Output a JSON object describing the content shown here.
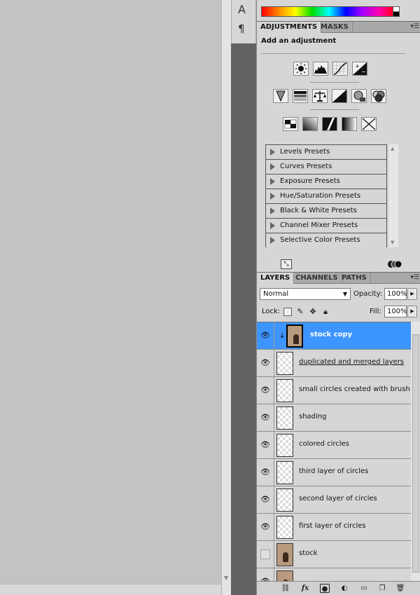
{
  "tools": {
    "type_tool": "A",
    "paragraph": "¶"
  },
  "adjustments": {
    "tabs": [
      "ADJUSTMENTS",
      "MASKS"
    ],
    "heading": "Add an adjustment",
    "row1": [
      "brightness-contrast-icon",
      "levels-icon",
      "curves-icon",
      "exposure-icon"
    ],
    "row2": [
      "vibrance-icon",
      "hue-saturation-icon",
      "color-balance-icon",
      "black-white-icon",
      "photo-filter-icon",
      "channel-mixer-icon"
    ],
    "row3": [
      "invert-icon",
      "posterize-icon",
      "threshold-icon",
      "gradient-map-icon",
      "selective-color-icon"
    ],
    "presets": [
      "Levels Presets",
      "Curves Presets",
      "Exposure Presets",
      "Hue/Saturation Presets",
      "Black & White Presets",
      "Channel Mixer Presets",
      "Selective Color Presets"
    ]
  },
  "layers_panel": {
    "tabs": [
      "LAYERS",
      "CHANNELS",
      "PATHS"
    ],
    "blend_mode": "Normal",
    "opacity_label": "Opacity:",
    "opacity_value": "100%",
    "lock_label": "Lock:",
    "fill_label": "Fill:",
    "fill_value": "100%",
    "layers": [
      {
        "name": "stock copy",
        "visible": true,
        "selected": true,
        "thumb": "photo"
      },
      {
        "name": "duplicated and merged layers",
        "visible": true,
        "selected": false,
        "thumb": "transparent"
      },
      {
        "name": "small circles created with brush",
        "visible": true,
        "selected": false,
        "thumb": "transparent"
      },
      {
        "name": "shading",
        "visible": true,
        "selected": false,
        "thumb": "transparent"
      },
      {
        "name": "colored circles",
        "visible": true,
        "selected": false,
        "thumb": "transparent"
      },
      {
        "name": "third layer of circles",
        "visible": true,
        "selected": false,
        "thumb": "transparent"
      },
      {
        "name": "second layer of circles",
        "visible": true,
        "selected": false,
        "thumb": "transparent"
      },
      {
        "name": "first layer of circles",
        "visible": true,
        "selected": false,
        "thumb": "transparent"
      },
      {
        "name": "stock",
        "visible": false,
        "selected": false,
        "thumb": "photo"
      }
    ]
  },
  "colors": {
    "selection": "#3d95ff",
    "panel_bg": "#d6d6d6",
    "canvas_bg": "#c3c3c3"
  }
}
